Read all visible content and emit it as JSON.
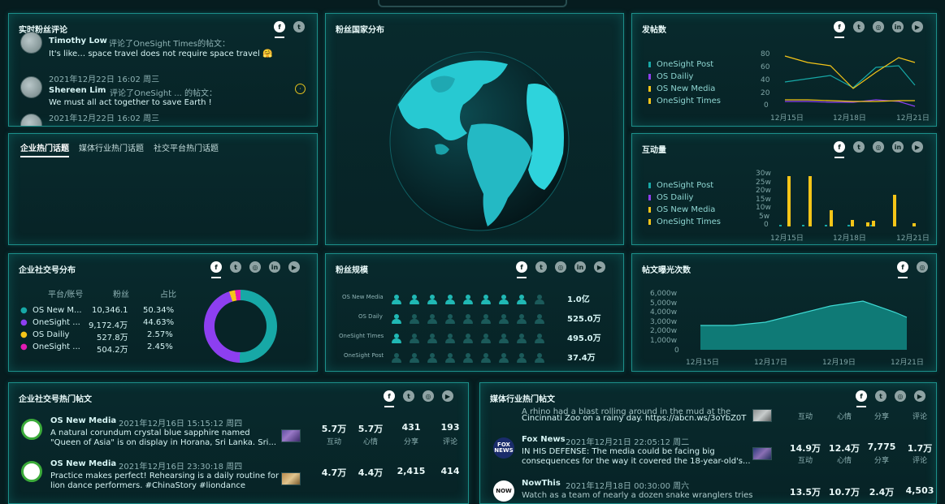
{
  "comments": {
    "title": "实时粉丝评论",
    "items": [
      {
        "name": "Timothy Low",
        "action": "评论了OneSight Times的帖文：",
        "text": "It's like… space travel does not require space travel 🤗"
      },
      {
        "time": "2021年12月22日 16:02 周三",
        "name": "Shereen Lim",
        "action": "评论了OneSight ... 的帖文：",
        "text": "We must all act together to save Earth !"
      },
      {
        "time": "2021年12月22日 16:02 周三"
      }
    ]
  },
  "topics": {
    "tabs": [
      "企业热门话题",
      "媒体行业热门话题",
      "社交平台热门话题"
    ]
  },
  "globe": {
    "title": "粉丝国家分布"
  },
  "posts_count": {
    "title": "发帖数",
    "legend": [
      "OneSight Post",
      "OS Dailiy",
      "OS New Media",
      "OneSight Times"
    ],
    "y_ticks": [
      "80",
      "60",
      "40",
      "20",
      "0"
    ],
    "x_ticks": [
      "12月15日",
      "12月18日",
      "12月21日"
    ]
  },
  "interactions": {
    "title": "互动量",
    "legend": [
      "OneSight Post",
      "OS Dailiy",
      "OS New Media",
      "OneSight Times"
    ],
    "y_ticks": [
      "30w",
      "25w",
      "20w",
      "15w",
      "10w",
      "5w",
      "0"
    ],
    "x_ticks": [
      "12月15日",
      "12月18日",
      "12月21日"
    ]
  },
  "accounts": {
    "title": "企业社交号分布",
    "headers": [
      "平台/账号",
      "粉丝",
      "占比"
    ],
    "rows": [
      {
        "name": "OS New M...",
        "fans": "10,346.1",
        "pct": "50.34%",
        "color": "#17a8a6"
      },
      {
        "name": "OneSight ...",
        "fans": "9,172.4万",
        "pct": "44.63%",
        "color": "#8d3ff0"
      },
      {
        "name": "OS Dailiy",
        "fans": "527.8万",
        "pct": "2.57%",
        "color": "#f5c518"
      },
      {
        "name": "OneSight ...",
        "fans": "504.2万",
        "pct": "2.45%",
        "color": "#e21bb3"
      }
    ]
  },
  "fan_scale": {
    "title": "粉丝规模",
    "rows": [
      {
        "label": "OS New Media",
        "value": "1.0亿"
      },
      {
        "label": "OS Daily",
        "value": "525.0万"
      },
      {
        "label": "OneSight Times",
        "value": "495.0万"
      },
      {
        "label": "OneSight Post",
        "value": "37.4万"
      }
    ]
  },
  "exposure": {
    "title": "帖文曝光次数",
    "y_ticks": [
      "6,000w",
      "5,000w",
      "4,000w",
      "3,000w",
      "2,000w",
      "1,000w",
      "0"
    ],
    "x_ticks": [
      "12月15日",
      "12月17日",
      "12月19日",
      "12月21日"
    ]
  },
  "ent_posts": {
    "title": "企业社交号热门帖文",
    "items": [
      {
        "source": "OS New Media",
        "time": "2021年12月16日 15:15:12 周四",
        "text1": "A natural corundum crystal blue sapphire named",
        "text2": "\"Queen of Asia\" is on display in Horana, Sri Lanka. Sri...",
        "s1": "5.7万",
        "s2": "5.7万",
        "s3": "431",
        "s4": "193"
      },
      {
        "source": "OS New Media",
        "time": "2021年12月16日 23:30:18 周四",
        "text1": "Practice makes perfect! Rehearsing is a daily routine for",
        "text2": "lion dance performers. #ChinaStory #liondance",
        "s1": "4.7万",
        "s2": "4.4万",
        "s3": "2,415",
        "s4": "414"
      }
    ],
    "stat_labels": [
      "互动",
      "心情",
      "分享",
      "评论"
    ]
  },
  "media_posts": {
    "title": "媒体行业热门帖文",
    "items": [
      {
        "text0": "A rhino had a blast rolling around in the mud at the",
        "text1": "Cincinnati Zoo on a rainy day. https://abcn.ws/3oYbZ0T"
      },
      {
        "source": "Fox News",
        "time": "2021年12月21日 22:05:12 周二",
        "text1": "IN HIS DEFENSE: The media could be facing big",
        "text2": "consequences for the way it covered the 18-year-old's...",
        "s1": "14.9万",
        "s2": "12.4万",
        "s3": "7,775",
        "s4": "1.7万"
      },
      {
        "source": "NowThis",
        "time": "2021年12月18日 00:30:00 周六",
        "text1": "Watch as a team of nearly a dozen snake wranglers tries",
        "s1": "13.5万",
        "s2": "10.7万",
        "s3": "2.4万",
        "s4": "4,503"
      }
    ],
    "stat_labels": [
      "互动",
      "心情",
      "分享",
      "评论"
    ]
  },
  "colors": {
    "teal": "#17a8a6",
    "purple": "#8d3ff0",
    "yellow": "#f5c518",
    "magenta": "#e21bb3"
  }
}
